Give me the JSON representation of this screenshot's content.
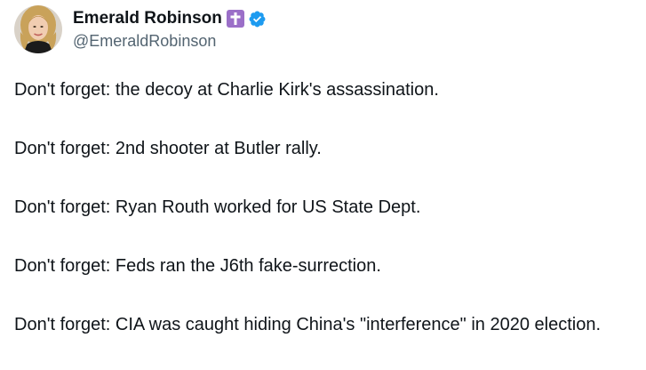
{
  "author": {
    "display_name": "Emerald Robinson",
    "handle": "@EmeraldRobinson",
    "name_emoji_icon": "latin-cross-icon",
    "verified_icon": "verified-badge-icon",
    "avatar_icon": "profile-avatar"
  },
  "tweet": {
    "paragraphs": [
      "Don't forget: the decoy at Charlie Kirk's assassination.",
      "Don't forget: 2nd shooter at Butler rally.",
      "Don't forget: Ryan Routh worked for US State Dept.",
      "Don't forget: Feds ran the J6th fake-surrection.",
      "Don't forget: CIA was caught hiding China's \"interference\" in 2020 election."
    ]
  },
  "colors": {
    "text_primary": "#0f1419",
    "text_secondary": "#536471",
    "verified_blue": "#1d9bf0",
    "cross_purple": "#9b6fc8",
    "background": "#ffffff"
  }
}
